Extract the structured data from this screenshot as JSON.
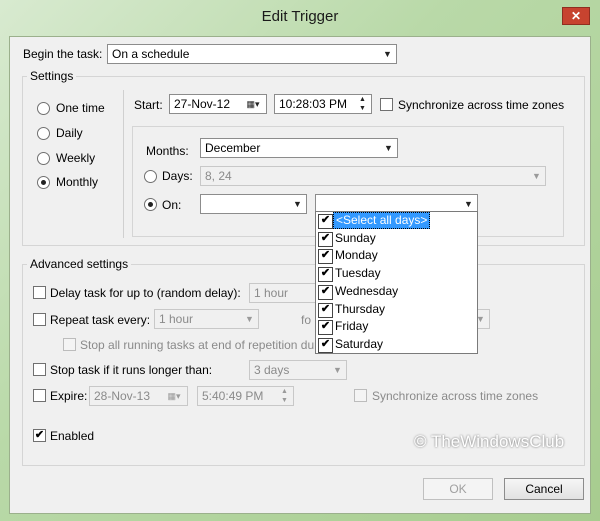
{
  "window": {
    "title": "Edit Trigger",
    "close_glyph": "✕"
  },
  "begin_task": {
    "label": "Begin the task:",
    "value": "On a schedule"
  },
  "settings": {
    "legend": "Settings",
    "schedule_options": [
      "One time",
      "Daily",
      "Weekly",
      "Monthly"
    ],
    "selected_schedule": "Monthly",
    "start_label": "Start:",
    "start_date": "27-Nov-12",
    "start_time": "10:28:03 PM",
    "sync_label": "Synchronize across time zones",
    "months_label": "Months:",
    "months_value": "December",
    "days_label": "Days:",
    "days_value": "8, 24",
    "on_label": "On:",
    "on_week_value": "",
    "on_day_value": ""
  },
  "day_dropdown": {
    "items": [
      "<Select all days>",
      "Sunday",
      "Monday",
      "Tuesday",
      "Wednesday",
      "Thursday",
      "Friday",
      "Saturday"
    ],
    "checked": [
      true,
      true,
      true,
      true,
      true,
      true,
      true,
      true
    ]
  },
  "advanced": {
    "legend": "Advanced settings",
    "delay_label": "Delay task for up to (random delay):",
    "delay_value": "1 hour",
    "repeat_label": "Repeat task every:",
    "repeat_value": "1 hour",
    "repeat_for_label": "fo",
    "stop_running_label": "Stop all running tasks at end of repetition dur",
    "stop_longer_label": "Stop task if it runs longer than:",
    "stop_longer_value": "3 days",
    "expire_label": "Expire:",
    "expire_date": "28-Nov-13",
    "expire_time": "5:40:49 PM",
    "expire_sync_label": "Synchronize across time zones",
    "enabled_label": "Enabled",
    "enabled_checked": true
  },
  "buttons": {
    "ok": "OK",
    "cancel": "Cancel"
  },
  "watermark": "© TheWindowsClub",
  "colors": {
    "accent_selection": "#3399ff",
    "titlebar_close": "#c7432f"
  }
}
